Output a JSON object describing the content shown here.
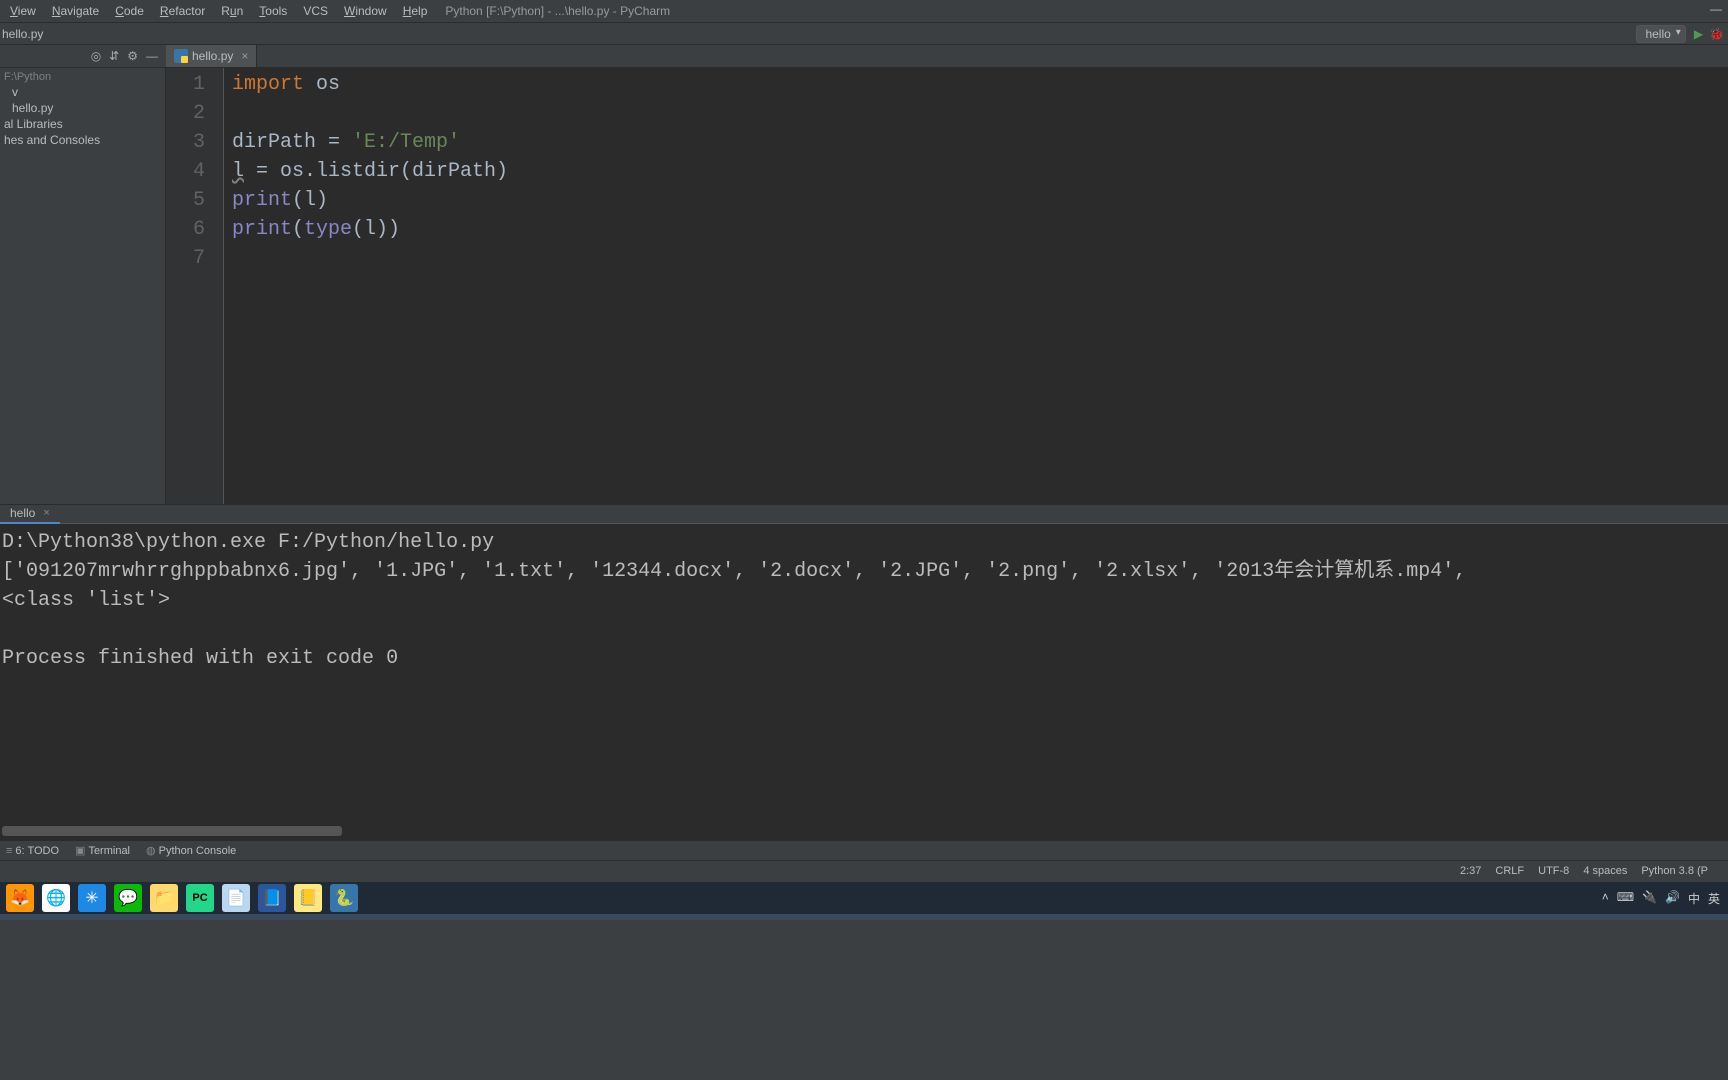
{
  "menubar": {
    "items": [
      {
        "u": "V",
        "rest": "iew"
      },
      {
        "u": "N",
        "rest": "avigate"
      },
      {
        "u": "C",
        "rest": "ode"
      },
      {
        "u": "R",
        "rest": "efactor"
      },
      {
        "u": "",
        "rest": "Run",
        "uchar": "R",
        "pre": "",
        "u2": "u"
      },
      {
        "u": "T",
        "rest": "ools"
      },
      {
        "u": "",
        "rest": "VCS",
        "plain": true
      },
      {
        "u": "W",
        "rest": "indow"
      },
      {
        "u": "H",
        "rest": "elp"
      }
    ],
    "view": "View",
    "navigate": "Navigate",
    "code": "Code",
    "refactor": "Refactor",
    "run": "Run",
    "tools": "Tools",
    "vcs": "VCS",
    "window": "Window",
    "help": "Help",
    "title": "Python [F:\\Python] - ...\\hello.py - PyCharm"
  },
  "breadcrumb": {
    "file": "hello.py"
  },
  "run_config": {
    "name": "hello"
  },
  "editor_tab": {
    "name": "hello.py"
  },
  "project": {
    "root_loc": "F:\\Python",
    "items": [
      "v",
      "hello.py",
      "al Libraries",
      "hes and Consoles"
    ]
  },
  "gutter": [
    "1",
    "2",
    "3",
    "4",
    "5",
    "6",
    "7"
  ],
  "code": {
    "l1": {
      "kw": "import",
      "rest": " os"
    },
    "l3": {
      "pre": "dirPath = ",
      "str": "'E:/Temp'"
    },
    "l4": "l = os.listdir(dirPath)",
    "l4_parts": {
      "lvar": "l",
      "rest": " = os.listdir(dirPath)"
    },
    "l5": {
      "fn": "print",
      "args": "(l)"
    },
    "l6": {
      "fn": "print",
      "args_open": "(",
      "type": "type",
      "args_mid": "(l))"
    }
  },
  "run_tab": {
    "name": "hello"
  },
  "console": {
    "line1": "D:\\Python38\\python.exe F:/Python/hello.py",
    "line2": "['091207mrwhrrghppbabnx6.jpg', '1.JPG', '1.txt', '12344.docx', '2.docx', '2.JPG', '2.png', '2.xlsx', '2013年会计算机系.mp4',",
    "line3": "<class 'list'>",
    "line4": "",
    "line5": "Process finished with exit code 0"
  },
  "bottom_tools": {
    "todo": "6: TODO",
    "terminal": "Terminal",
    "pyconsole": "Python Console"
  },
  "status": {
    "pos": "2:37",
    "eol": "CRLF",
    "enc": "UTF-8",
    "indent": "4 spaces",
    "interp": "Python 3.8 (P"
  },
  "taskbar": {
    "icons": [
      "🦊",
      "🌐",
      "✳",
      "💬",
      "📁",
      "PC",
      "📄",
      "📘",
      "📒",
      "🐍"
    ]
  },
  "tray": {
    "items": [
      "˄",
      "⌨",
      "🔌",
      "🔊",
      "中",
      "英"
    ]
  }
}
